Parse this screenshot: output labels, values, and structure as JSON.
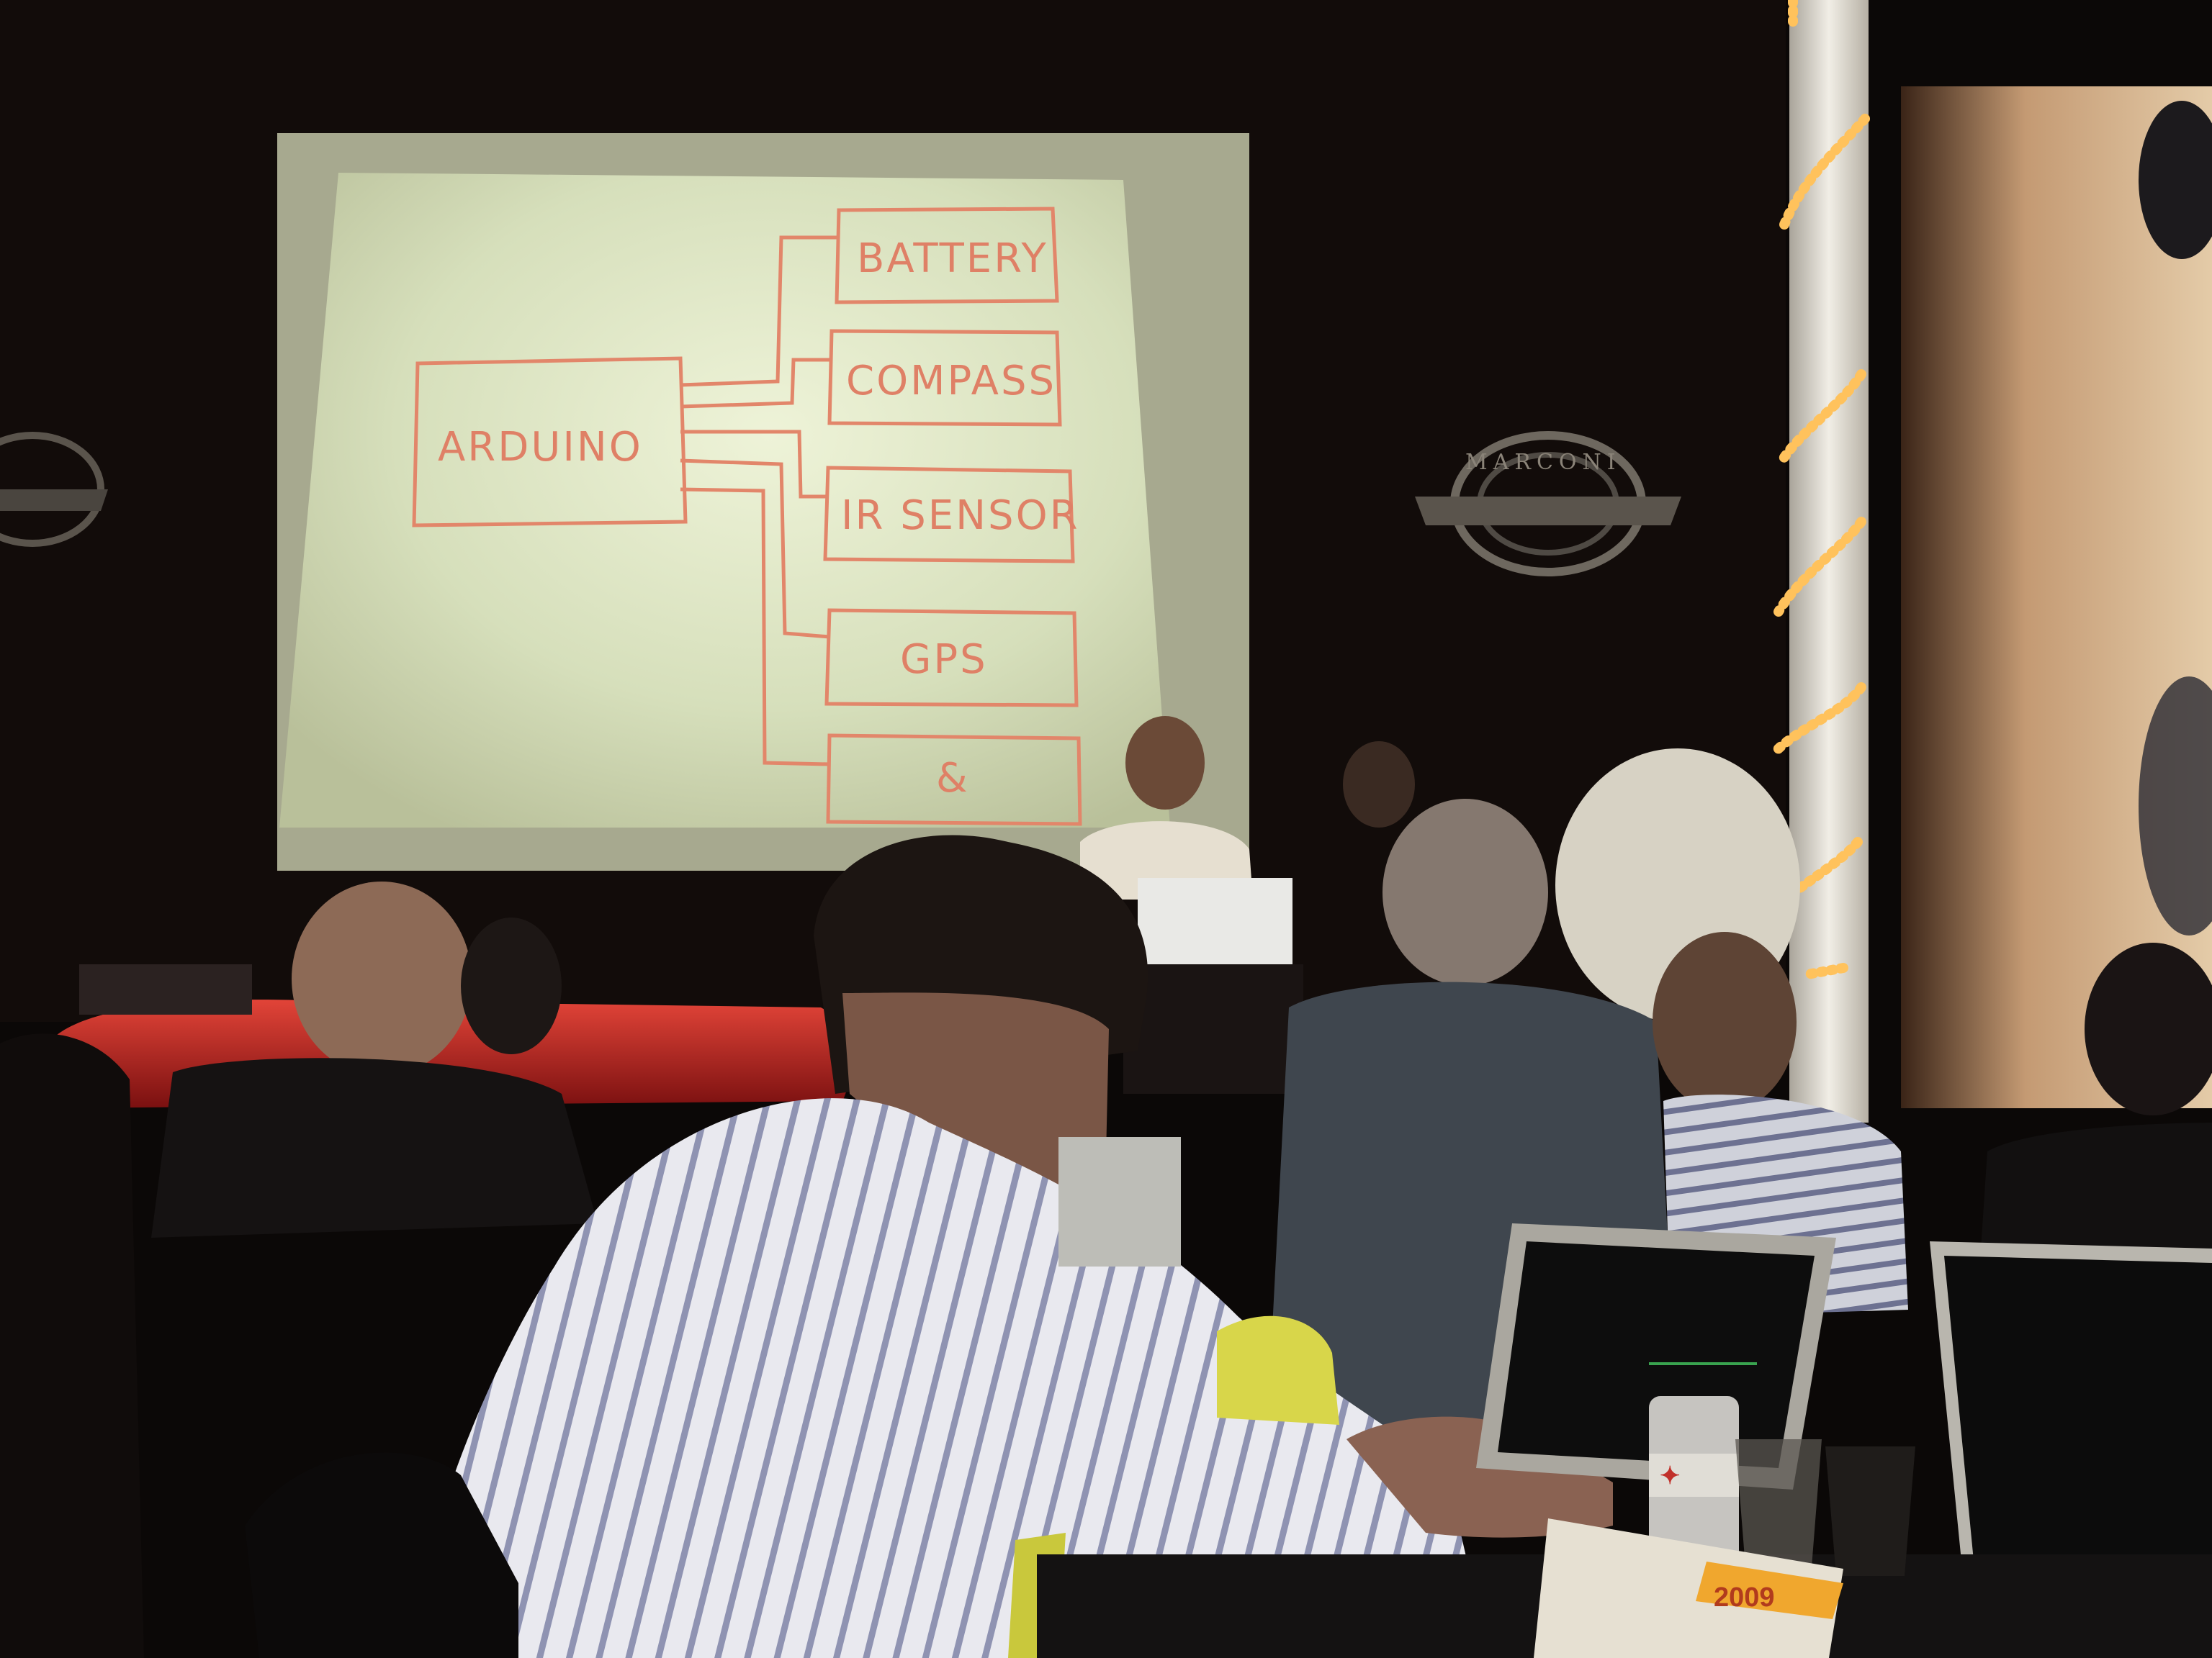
{
  "slide": {
    "main_block": "ARDUINO",
    "components": [
      "BATTERY",
      "COMPASS",
      "IR SENSOR",
      "GPS",
      "&"
    ]
  },
  "venue_logo": {
    "name": "MARCONI"
  },
  "flyer_text": "2009",
  "colors": {
    "slide_bg": "#d9e3c0",
    "marker": "#e2866a",
    "room": "#0b0807",
    "string_lights": "#ffc25c",
    "car": "#b81e1e"
  }
}
